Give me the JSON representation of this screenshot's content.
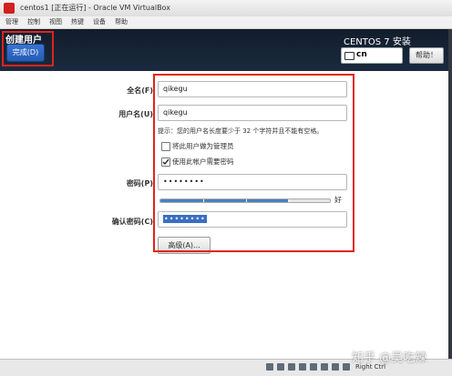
{
  "window": {
    "title": "centos1 [正在运行] - Oracle VM VirtualBox",
    "menu": [
      "管理",
      "控制",
      "视图",
      "热键",
      "设备",
      "帮助"
    ]
  },
  "header": {
    "page_title": "创建用户",
    "done_label": "完成(D)",
    "os_title": "CENTOS 7 安装",
    "keyboard_layout": "cn",
    "help_label": "帮助！"
  },
  "form": {
    "fullname_label": "全名(F)",
    "fullname_value": "qikegu",
    "username_label": "用户名(U)",
    "username_value": "qikegu",
    "hint": "提示：您的用户名长度要少于 32 个字符并且不能有空格。",
    "admin_checkbox": {
      "label": "将此用户做为管理员",
      "checked": false
    },
    "require_password_checkbox": {
      "label": "使用此帐户需要密码",
      "checked": true
    },
    "password_label": "密码(P)",
    "password_value": "••••••••",
    "strength_label": "好",
    "strength_level": 0.75,
    "confirm_label": "确认密码(C)",
    "confirm_value": "••••••••",
    "advanced_label": "高级(A)..."
  },
  "statusbar": {
    "host_key": "Right Ctrl"
  },
  "watermark": "知乎 @吴吃辣",
  "colors": {
    "highlight": "#e2231a",
    "done_button": "#2f68c4",
    "header_bg": "#121d2b"
  }
}
